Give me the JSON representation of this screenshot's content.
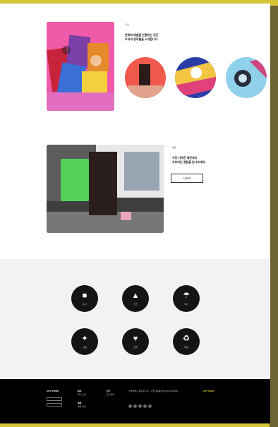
{
  "section1": {
    "label": "소개",
    "title_line1": "문화와 예술을 연결하는 공간",
    "title_line2": "우리의 창작물을 소개합니다."
  },
  "section2": {
    "label": "매장",
    "title_line1": "가장 가까운 매장에서",
    "title_line2": "오프라인 경험을 만나보세요.",
    "button_label": "자세히"
  },
  "services": [
    {
      "icon": "book-icon",
      "glyph": "■",
      "label": "도서"
    },
    {
      "icon": "shirt-icon",
      "glyph": "▲",
      "label": "굿즈"
    },
    {
      "icon": "umbrella-icon",
      "glyph": "☂",
      "label": "우산"
    },
    {
      "icon": "bird-icon",
      "glyph": "✦",
      "label": "소품"
    },
    {
      "icon": "heart-icon",
      "glyph": "♥",
      "label": "선물"
    },
    {
      "icon": "recycle-icon",
      "glyph": "♻",
      "label": "재생"
    }
  ],
  "footer": {
    "logo": "ART STORE",
    "col1_head": "회사",
    "col1_text": "회사 소개",
    "col2_head": "고객",
    "col2_text": "고객 센터",
    "col3_head": "매장",
    "col3_text": "매장 안내",
    "col4_text": "서울특별시 문화로 123 · 사업자등록번호 000-00-00000",
    "accent_text": "ART SHOP"
  }
}
